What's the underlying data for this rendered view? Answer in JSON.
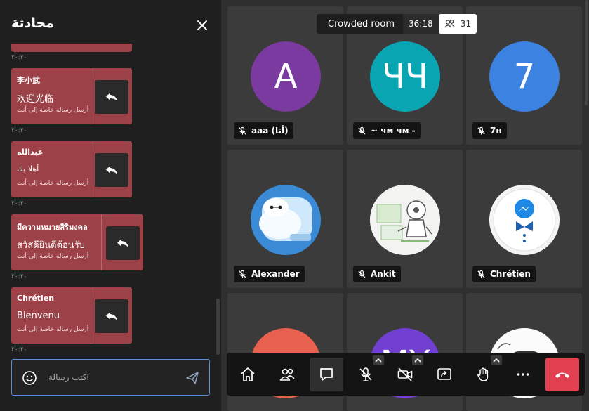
{
  "chat": {
    "title": "محادثة",
    "messages": [
      {
        "timestamp": "٢٠:٣٠"
      },
      {
        "sender": "李小武",
        "text": "欢迎光临",
        "private_note": "أرسل رسالة خاصة إلى أنت",
        "timestamp": "٢٠:٣٠"
      },
      {
        "sender": "عبدالله",
        "text": "أهلا بك",
        "private_note": "أرسل رسالة خاصة إلى أنت",
        "timestamp": "٢٠:٣٠"
      },
      {
        "sender": "มีความหมายสิริมงคล",
        "text": "สวัสดียินดีต้อนรับ",
        "private_note": "أرسل رسالة خاصة إلى أنت",
        "timestamp": "٢٠:٣٠"
      },
      {
        "sender": "Chrétien",
        "text": "Bienvenu",
        "private_note": "أرسل رسالة خاصة إلى أنت",
        "timestamp": "٢٠:٣٠"
      }
    ],
    "input": {
      "placeholder": "اكتب رسالة",
      "value": ""
    }
  },
  "room": {
    "name": "Crowded room",
    "timer": "36:18",
    "participant_count": "31"
  },
  "tiles": [
    {
      "name": "aaa (أنا)",
      "initials": "A",
      "color": "#7b3aa0"
    },
    {
      "name": "~ чм чм -",
      "initials": "ЧЧ",
      "color": "#0aa5b3"
    },
    {
      "name": "7н",
      "initials": "7",
      "color": "#3c82e0"
    },
    {
      "name": "Alexander",
      "avatar": "robot-character"
    },
    {
      "name": "Ankit",
      "avatar": "robot-sketch"
    },
    {
      "name": "Chrétien",
      "avatar": "messenger-butler"
    },
    {
      "name": "",
      "initials": "",
      "color": "#e8604e"
    },
    {
      "name": "",
      "initials": "MY",
      "color": "#7140d0"
    },
    {
      "name": "",
      "avatar": "hello-sticker"
    }
  ],
  "toolbar": {
    "buttons": [
      "home-icon",
      "participants-icon",
      "chat-icon",
      "microphone-muted-icon",
      "camera-off-icon",
      "share-screen-icon",
      "raise-hand-icon",
      "more-icon",
      "hangup-icon"
    ],
    "active": "chat-icon"
  },
  "colors": {
    "accent": "#5a8fd6",
    "message_bubble": "#9b4147",
    "hangup": "#e04050",
    "background": "#2f2f2f"
  }
}
